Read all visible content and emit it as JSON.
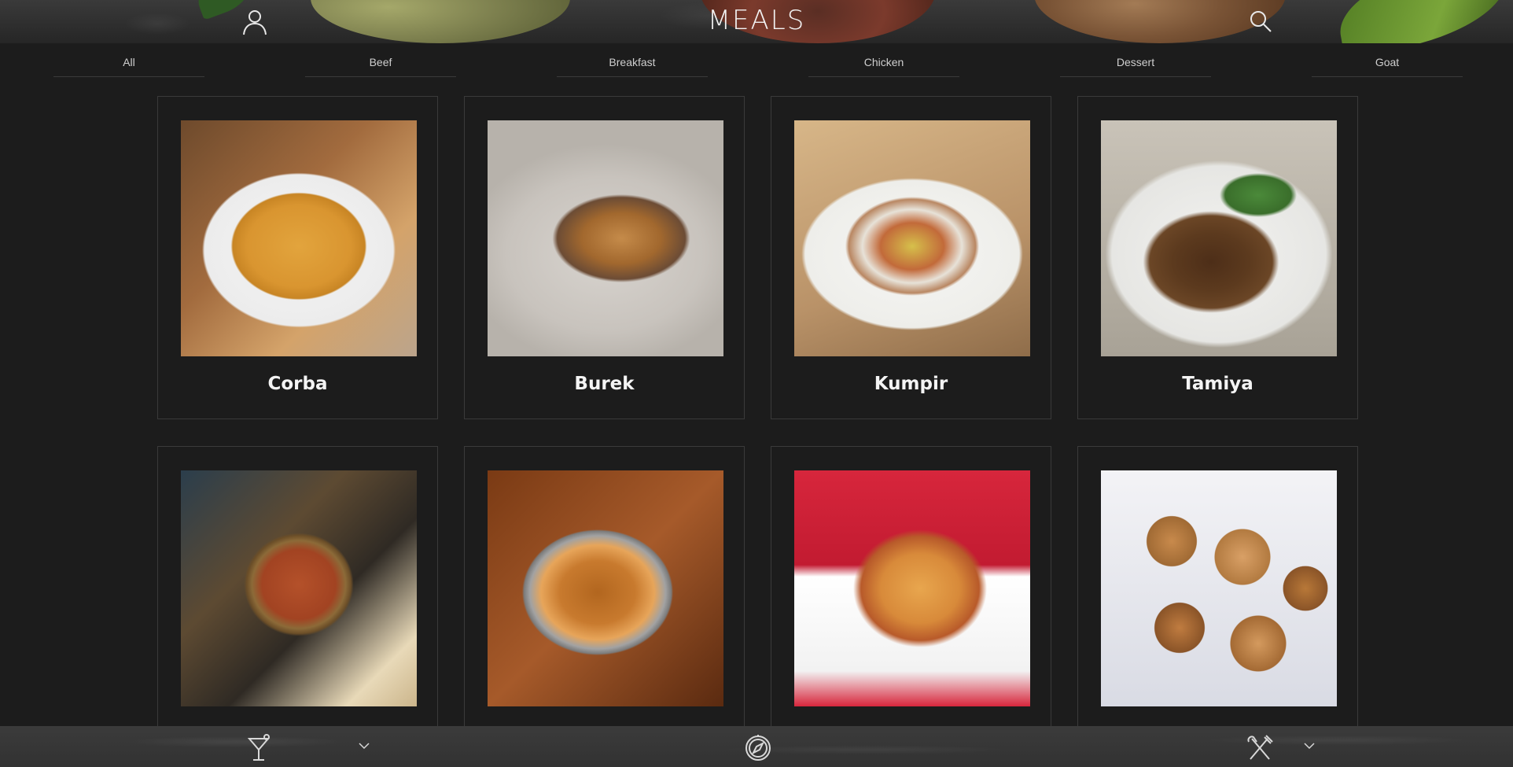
{
  "header": {
    "title": "MEALS",
    "user_icon": "user-icon",
    "search_icon": "search-icon"
  },
  "categories": [
    {
      "label": "All"
    },
    {
      "label": "Beef"
    },
    {
      "label": "Breakfast"
    },
    {
      "label": "Chicken"
    },
    {
      "label": "Dessert"
    },
    {
      "label": "Goat"
    }
  ],
  "meals": [
    {
      "name": "Corba",
      "image": "corba-soup"
    },
    {
      "name": "Burek",
      "image": "burek-pastry"
    },
    {
      "name": "Kumpir",
      "image": "kumpir-potato"
    },
    {
      "name": "Tamiya",
      "image": "tamiya-falafel"
    },
    {
      "name": "",
      "image": "lentil-soup"
    },
    {
      "name": "",
      "image": "poutine"
    },
    {
      "name": "",
      "image": "lasagna"
    },
    {
      "name": "",
      "image": "sugar-donuts"
    }
  ],
  "footer": {
    "drinks_icon": "cocktail-icon",
    "explore_icon": "compass-icon",
    "meals_icon": "fork-knife-icon"
  },
  "colors": {
    "background": "#1c1c1c",
    "card_border": "#3a3a3a",
    "text": "#f4f4f4",
    "category_text": "#cfcfcf"
  }
}
